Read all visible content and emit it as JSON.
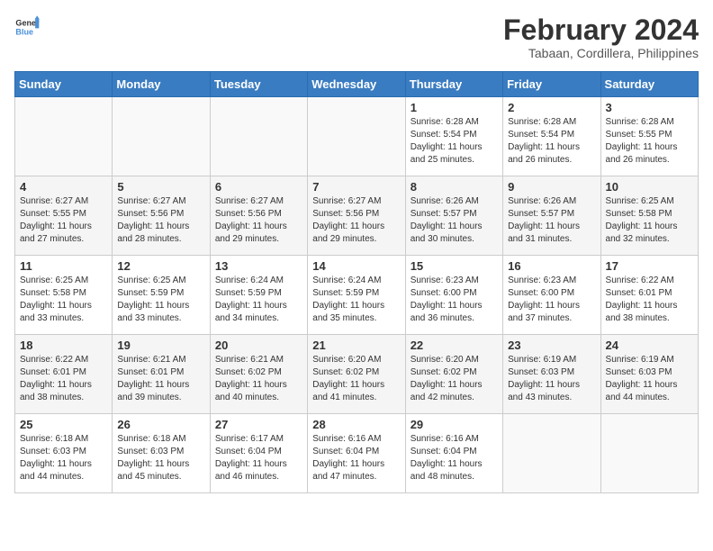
{
  "header": {
    "logo_general": "General",
    "logo_blue": "Blue",
    "month_year": "February 2024",
    "location": "Tabaan, Cordillera, Philippines"
  },
  "days_of_week": [
    "Sunday",
    "Monday",
    "Tuesday",
    "Wednesday",
    "Thursday",
    "Friday",
    "Saturday"
  ],
  "weeks": [
    [
      {
        "day": "",
        "info": ""
      },
      {
        "day": "",
        "info": ""
      },
      {
        "day": "",
        "info": ""
      },
      {
        "day": "",
        "info": ""
      },
      {
        "day": "1",
        "info": "Sunrise: 6:28 AM\nSunset: 5:54 PM\nDaylight: 11 hours and 25 minutes."
      },
      {
        "day": "2",
        "info": "Sunrise: 6:28 AM\nSunset: 5:54 PM\nDaylight: 11 hours and 26 minutes."
      },
      {
        "day": "3",
        "info": "Sunrise: 6:28 AM\nSunset: 5:55 PM\nDaylight: 11 hours and 26 minutes."
      }
    ],
    [
      {
        "day": "4",
        "info": "Sunrise: 6:27 AM\nSunset: 5:55 PM\nDaylight: 11 hours and 27 minutes."
      },
      {
        "day": "5",
        "info": "Sunrise: 6:27 AM\nSunset: 5:56 PM\nDaylight: 11 hours and 28 minutes."
      },
      {
        "day": "6",
        "info": "Sunrise: 6:27 AM\nSunset: 5:56 PM\nDaylight: 11 hours and 29 minutes."
      },
      {
        "day": "7",
        "info": "Sunrise: 6:27 AM\nSunset: 5:56 PM\nDaylight: 11 hours and 29 minutes."
      },
      {
        "day": "8",
        "info": "Sunrise: 6:26 AM\nSunset: 5:57 PM\nDaylight: 11 hours and 30 minutes."
      },
      {
        "day": "9",
        "info": "Sunrise: 6:26 AM\nSunset: 5:57 PM\nDaylight: 11 hours and 31 minutes."
      },
      {
        "day": "10",
        "info": "Sunrise: 6:25 AM\nSunset: 5:58 PM\nDaylight: 11 hours and 32 minutes."
      }
    ],
    [
      {
        "day": "11",
        "info": "Sunrise: 6:25 AM\nSunset: 5:58 PM\nDaylight: 11 hours and 33 minutes."
      },
      {
        "day": "12",
        "info": "Sunrise: 6:25 AM\nSunset: 5:59 PM\nDaylight: 11 hours and 33 minutes."
      },
      {
        "day": "13",
        "info": "Sunrise: 6:24 AM\nSunset: 5:59 PM\nDaylight: 11 hours and 34 minutes."
      },
      {
        "day": "14",
        "info": "Sunrise: 6:24 AM\nSunset: 5:59 PM\nDaylight: 11 hours and 35 minutes."
      },
      {
        "day": "15",
        "info": "Sunrise: 6:23 AM\nSunset: 6:00 PM\nDaylight: 11 hours and 36 minutes."
      },
      {
        "day": "16",
        "info": "Sunrise: 6:23 AM\nSunset: 6:00 PM\nDaylight: 11 hours and 37 minutes."
      },
      {
        "day": "17",
        "info": "Sunrise: 6:22 AM\nSunset: 6:01 PM\nDaylight: 11 hours and 38 minutes."
      }
    ],
    [
      {
        "day": "18",
        "info": "Sunrise: 6:22 AM\nSunset: 6:01 PM\nDaylight: 11 hours and 38 minutes."
      },
      {
        "day": "19",
        "info": "Sunrise: 6:21 AM\nSunset: 6:01 PM\nDaylight: 11 hours and 39 minutes."
      },
      {
        "day": "20",
        "info": "Sunrise: 6:21 AM\nSunset: 6:02 PM\nDaylight: 11 hours and 40 minutes."
      },
      {
        "day": "21",
        "info": "Sunrise: 6:20 AM\nSunset: 6:02 PM\nDaylight: 11 hours and 41 minutes."
      },
      {
        "day": "22",
        "info": "Sunrise: 6:20 AM\nSunset: 6:02 PM\nDaylight: 11 hours and 42 minutes."
      },
      {
        "day": "23",
        "info": "Sunrise: 6:19 AM\nSunset: 6:03 PM\nDaylight: 11 hours and 43 minutes."
      },
      {
        "day": "24",
        "info": "Sunrise: 6:19 AM\nSunset: 6:03 PM\nDaylight: 11 hours and 44 minutes."
      }
    ],
    [
      {
        "day": "25",
        "info": "Sunrise: 6:18 AM\nSunset: 6:03 PM\nDaylight: 11 hours and 44 minutes."
      },
      {
        "day": "26",
        "info": "Sunrise: 6:18 AM\nSunset: 6:03 PM\nDaylight: 11 hours and 45 minutes."
      },
      {
        "day": "27",
        "info": "Sunrise: 6:17 AM\nSunset: 6:04 PM\nDaylight: 11 hours and 46 minutes."
      },
      {
        "day": "28",
        "info": "Sunrise: 6:16 AM\nSunset: 6:04 PM\nDaylight: 11 hours and 47 minutes."
      },
      {
        "day": "29",
        "info": "Sunrise: 6:16 AM\nSunset: 6:04 PM\nDaylight: 11 hours and 48 minutes."
      },
      {
        "day": "",
        "info": ""
      },
      {
        "day": "",
        "info": ""
      }
    ]
  ]
}
